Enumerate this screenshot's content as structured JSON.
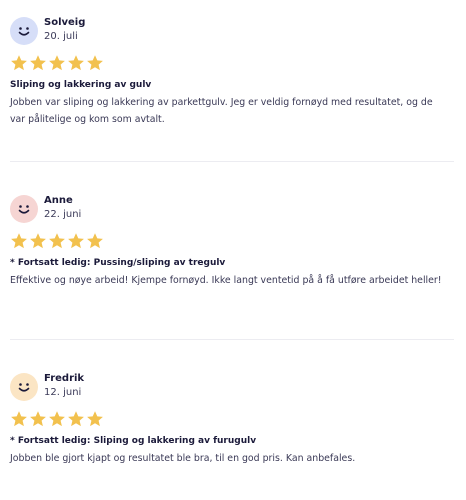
{
  "colors": {
    "star": "#f2c14e",
    "text_primary": "#1b1a3a",
    "text_secondary": "#3a3956",
    "divider": "#ececf1"
  },
  "reviews": [
    {
      "name": "Solveig",
      "date": "20. juli",
      "rating": 5,
      "avatar_color": "#d6def8",
      "title": "Sliping og lakkering av gulv",
      "text": "Jobben var sliping og lakkering av parkettgulv. Jeg er veldig fornøyd med resultatet, og de var pålitelige og kom som avtalt."
    },
    {
      "name": "Anne",
      "date": "22. juni",
      "rating": 5,
      "avatar_color": "#f6d5d3",
      "title": "* Fortsatt ledig: Pussing/sliping av tregulv",
      "text": "Effektive og nøye arbeid! Kjempe fornøyd. Ikke langt ventetid på å få utføre arbeidet heller!"
    },
    {
      "name": "Fredrik",
      "date": "12. juni",
      "rating": 5,
      "avatar_color": "#fbe5c4",
      "title": "* Fortsatt ledig: Sliping og lakkering av furugulv",
      "text": "Jobben ble gjort kjapt og resultatet ble bra, til en god pris. Kan anbefales."
    }
  ]
}
